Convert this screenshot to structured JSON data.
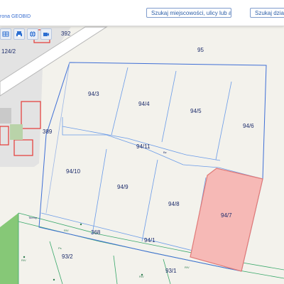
{
  "header": {
    "brand_text": "rona GEOBID",
    "search_address_label": "Szukaj miejscowości, ulicy lub adresu",
    "search_parcel_label": "Szukaj działki"
  },
  "toolbar": {
    "tools": [
      {
        "icon": "table-icon"
      },
      {
        "icon": "print-icon"
      },
      {
        "icon": "globe-icon"
      },
      {
        "icon": "camera-icon"
      }
    ]
  },
  "map": {
    "selected_parcel": "94/7",
    "colors": {
      "selected_fill": "#f6b9b6",
      "parcel_line": "#3f6fd6",
      "building": "#e53935",
      "green": "#7ac36a"
    },
    "parcel_labels": [
      "392",
      "95",
      "124/2",
      "94/3",
      "94/4",
      "94/5",
      "94/6",
      "389",
      "94/11",
      "94/10",
      "94/9",
      "94/8",
      "94/7",
      "368",
      "94/1",
      "93/2",
      "93/1"
    ],
    "small_labels": [
      "Bz",
      "Tereny",
      "Ps",
      "RIV",
      "RIV",
      "RIV",
      "RIV"
    ]
  }
}
